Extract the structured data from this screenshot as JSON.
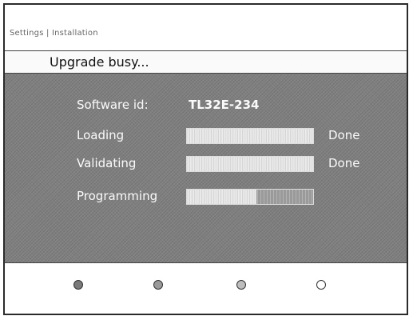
{
  "breadcrumb": "Settings | Installation",
  "title": "Upgrade busy...",
  "software_id": {
    "label": "Software id:",
    "value": "TL32E-234"
  },
  "steps": [
    {
      "label": "Loading",
      "progress": 1.0,
      "status": "Done"
    },
    {
      "label": "Validating",
      "progress": 1.0,
      "status": "Done"
    },
    {
      "label": "Programming",
      "progress": 0.55,
      "status": ""
    }
  ],
  "color_keys": [
    {
      "icon": "red-dot-icon",
      "fill": "#7a7a7a"
    },
    {
      "icon": "green-dot-icon",
      "fill": "#9a9a9a"
    },
    {
      "icon": "yellow-dot-icon",
      "fill": "#bdbdbd"
    },
    {
      "icon": "blue-dot-icon",
      "fill": "#ffffff"
    }
  ]
}
